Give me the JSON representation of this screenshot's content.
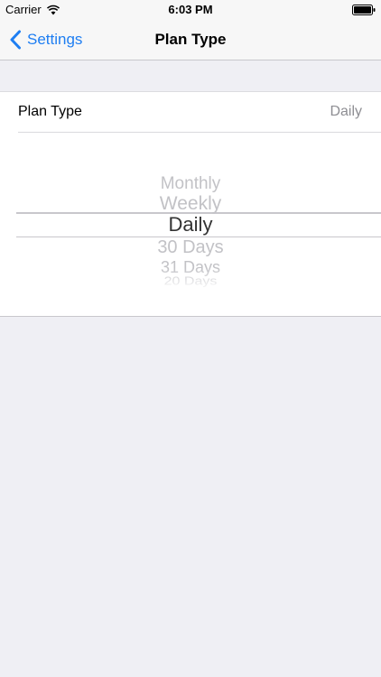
{
  "status_bar": {
    "carrier": "Carrier",
    "time": "6:03 PM",
    "wifi_icon": "wifi-icon",
    "battery_icon": "battery-icon"
  },
  "nav": {
    "back_label": "Settings",
    "back_icon": "chevron-left-icon",
    "title": "Plan Type"
  },
  "cell": {
    "label": "Plan Type",
    "value": "Daily"
  },
  "picker": {
    "options": [
      "Monthly",
      "Weekly",
      "Daily",
      "30 Days",
      "31 Days",
      "20 Days"
    ],
    "selected": "Daily"
  },
  "colors": {
    "accent": "#1e7ef2",
    "background": "#efeff4",
    "secondary_text": "#8e8e93"
  }
}
